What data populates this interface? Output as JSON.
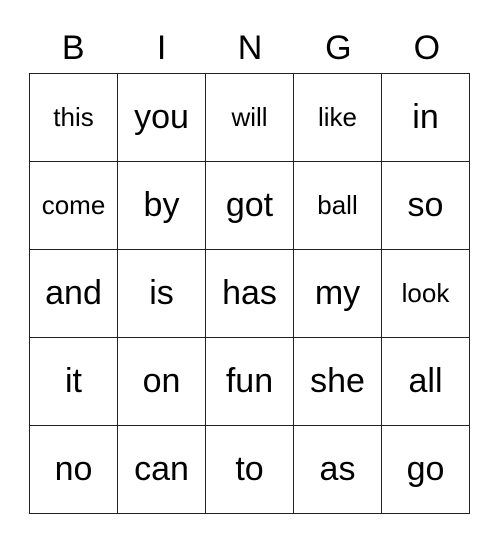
{
  "header": [
    "B",
    "I",
    "N",
    "G",
    "O"
  ],
  "cells": [
    [
      "this",
      "you",
      "will",
      "like",
      "in"
    ],
    [
      "come",
      "by",
      "got",
      "ball",
      "so"
    ],
    [
      "and",
      "is",
      "has",
      "my",
      "look"
    ],
    [
      "it",
      "on",
      "fun",
      "she",
      "all"
    ],
    [
      "no",
      "can",
      "to",
      "as",
      "go"
    ]
  ]
}
